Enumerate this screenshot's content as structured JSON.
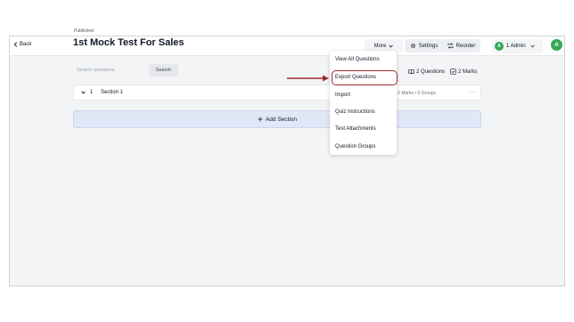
{
  "nav": {
    "back_label": "Back"
  },
  "user": {
    "admin_avatar": "A",
    "admin_label": "1 Admin",
    "profile_avatar": "A"
  },
  "quiz": {
    "status": "Published",
    "title": "1st Mock Test For Sales"
  },
  "toolbar": {
    "more_label": "More",
    "settings_label": "Settings",
    "reorder_label": "Reorder"
  },
  "search": {
    "placeholder": "Search questions",
    "button_label": "Search"
  },
  "summary": {
    "questions": "2 Questions",
    "marks": "2 Marks"
  },
  "section": {
    "number": "1",
    "name": "Section 1",
    "meta": "uestions • 2 Marks • 0 Groups",
    "menu": "···"
  },
  "add_section_label": "Add Section",
  "more_menu": {
    "items": [
      "View All Questions",
      "Export Questions",
      "Import",
      "Quiz Instructions",
      "Test Attachments",
      "Question Groups"
    ]
  },
  "colors": {
    "accent_green": "#34a853",
    "annotation": "#9e2a2b",
    "add_section_bg": "#e0e7f6"
  }
}
